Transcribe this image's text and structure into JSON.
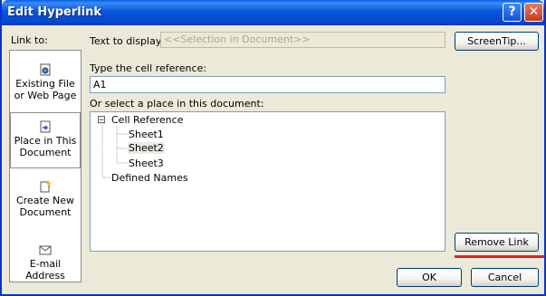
{
  "window": {
    "title": "Edit Hyperlink",
    "help_glyph": "?",
    "close_glyph": "✕"
  },
  "link_to": {
    "label": "Link to:",
    "items": [
      {
        "label": "Existing File or Web Page",
        "icon": "globe-document-icon"
      },
      {
        "label": "Place in This Document",
        "icon": "document-arrow-icon",
        "selected": true
      },
      {
        "label": "Create New Document",
        "icon": "new-document-icon"
      },
      {
        "label": "E-mail Address",
        "icon": "envelope-icon"
      }
    ]
  },
  "text_to_display": {
    "label": "Text to display:",
    "value": "<<Selection in Document>>"
  },
  "screentip_label": "ScreenTip...",
  "cell_reference": {
    "label": "Type the cell reference:",
    "value": "A1"
  },
  "place": {
    "label": "Or select a place in this document:",
    "expander_glyph": "⊟",
    "tree": [
      {
        "label": "Cell Reference",
        "children": [
          "Sheet1",
          "Sheet2",
          "Sheet3"
        ],
        "selected_child": "Sheet2"
      },
      {
        "label": "Defined Names"
      }
    ]
  },
  "remove_link_label": "Remove Link",
  "ok_label": "OK",
  "cancel_label": "Cancel",
  "colors": {
    "title_bar": "#0855dd",
    "dialog_bg": "#ece9d8",
    "highlight_underline": "#e4201b"
  }
}
